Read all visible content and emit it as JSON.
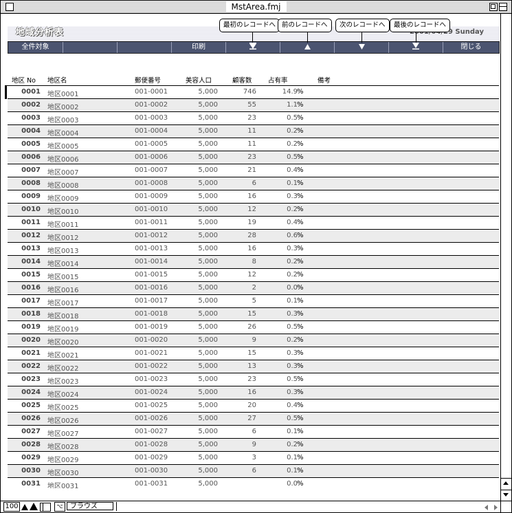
{
  "window": {
    "title": "MstArea.fmj"
  },
  "header": {
    "app_title": "地域分析表",
    "date": "2001/04/29 Sunday"
  },
  "toolbar": {
    "buttons": [
      {
        "label": "全件対象",
        "icon": ""
      },
      {
        "label": "",
        "icon": ""
      },
      {
        "label": "",
        "icon": ""
      },
      {
        "label": "印刷",
        "icon": ""
      },
      {
        "label": "",
        "icon": "first-record-icon"
      },
      {
        "label": "",
        "icon": "prev-record-icon"
      },
      {
        "label": "",
        "icon": "next-record-icon"
      },
      {
        "label": "",
        "icon": "last-record-icon"
      },
      {
        "label": "閉じる",
        "icon": ""
      }
    ]
  },
  "callouts": {
    "first": "最初のレコードへ",
    "prev": "前のレコードへ",
    "next": "次のレコードへ",
    "last": "最後のレコードへ"
  },
  "columns": {
    "no": "地区 No",
    "name": "地区名",
    "zip": "郵便番号",
    "pop": "美容人口",
    "cust": "顧客数",
    "rate": "占有率",
    "note": "備考"
  },
  "pct_symbol": "%",
  "rows": [
    {
      "no": "0001",
      "name": "地区0001",
      "zip": "001-0001",
      "pop": "5,000",
      "cust": "746",
      "rate": "14.9"
    },
    {
      "no": "0002",
      "name": "地区0002",
      "zip": "001-0002",
      "pop": "5,000",
      "cust": "55",
      "rate": "1.1"
    },
    {
      "no": "0003",
      "name": "地区0003",
      "zip": "001-0003",
      "pop": "5,000",
      "cust": "23",
      "rate": "0.5"
    },
    {
      "no": "0004",
      "name": "地区0004",
      "zip": "001-0004",
      "pop": "5,000",
      "cust": "11",
      "rate": "0.2"
    },
    {
      "no": "0005",
      "name": "地区0005",
      "zip": "001-0005",
      "pop": "5,000",
      "cust": "11",
      "rate": "0.2"
    },
    {
      "no": "0006",
      "name": "地区0006",
      "zip": "001-0006",
      "pop": "5,000",
      "cust": "23",
      "rate": "0.5"
    },
    {
      "no": "0007",
      "name": "地区0007",
      "zip": "001-0007",
      "pop": "5,000",
      "cust": "21",
      "rate": "0.4"
    },
    {
      "no": "0008",
      "name": "地区0008",
      "zip": "001-0008",
      "pop": "5,000",
      "cust": "6",
      "rate": "0.1"
    },
    {
      "no": "0009",
      "name": "地区0009",
      "zip": "001-0009",
      "pop": "5,000",
      "cust": "16",
      "rate": "0.3"
    },
    {
      "no": "0010",
      "name": "地区0010",
      "zip": "001-0010",
      "pop": "5,000",
      "cust": "12",
      "rate": "0.2"
    },
    {
      "no": "0011",
      "name": "地区0011",
      "zip": "001-0011",
      "pop": "5,000",
      "cust": "19",
      "rate": "0.4"
    },
    {
      "no": "0012",
      "name": "地区0012",
      "zip": "001-0012",
      "pop": "5,000",
      "cust": "28",
      "rate": "0.6"
    },
    {
      "no": "0013",
      "name": "地区0013",
      "zip": "001-0013",
      "pop": "5,000",
      "cust": "16",
      "rate": "0.3"
    },
    {
      "no": "0014",
      "name": "地区0014",
      "zip": "001-0014",
      "pop": "5,000",
      "cust": "8",
      "rate": "0.2"
    },
    {
      "no": "0015",
      "name": "地区0015",
      "zip": "001-0015",
      "pop": "5,000",
      "cust": "12",
      "rate": "0.2"
    },
    {
      "no": "0016",
      "name": "地区0016",
      "zip": "001-0016",
      "pop": "5,000",
      "cust": "2",
      "rate": "0.0"
    },
    {
      "no": "0017",
      "name": "地区0017",
      "zip": "001-0017",
      "pop": "5,000",
      "cust": "5",
      "rate": "0.1"
    },
    {
      "no": "0018",
      "name": "地区0018",
      "zip": "001-0018",
      "pop": "5,000",
      "cust": "15",
      "rate": "0.3"
    },
    {
      "no": "0019",
      "name": "地区0019",
      "zip": "001-0019",
      "pop": "5,000",
      "cust": "26",
      "rate": "0.5"
    },
    {
      "no": "0020",
      "name": "地区0020",
      "zip": "001-0020",
      "pop": "5,000",
      "cust": "9",
      "rate": "0.2"
    },
    {
      "no": "0021",
      "name": "地区0021",
      "zip": "001-0021",
      "pop": "5,000",
      "cust": "15",
      "rate": "0.3"
    },
    {
      "no": "0022",
      "name": "地区0022",
      "zip": "001-0022",
      "pop": "5,000",
      "cust": "13",
      "rate": "0.3"
    },
    {
      "no": "0023",
      "name": "地区0023",
      "zip": "001-0023",
      "pop": "5,000",
      "cust": "23",
      "rate": "0.5"
    },
    {
      "no": "0024",
      "name": "地区0024",
      "zip": "001-0024",
      "pop": "5,000",
      "cust": "16",
      "rate": "0.3"
    },
    {
      "no": "0025",
      "name": "地区0025",
      "zip": "001-0025",
      "pop": "5,000",
      "cust": "20",
      "rate": "0.4"
    },
    {
      "no": "0026",
      "name": "地区0026",
      "zip": "001-0026",
      "pop": "5,000",
      "cust": "27",
      "rate": "0.5"
    },
    {
      "no": "0027",
      "name": "地区0027",
      "zip": "001-0027",
      "pop": "5,000",
      "cust": "6",
      "rate": "0.1"
    },
    {
      "no": "0028",
      "name": "地区0028",
      "zip": "001-0028",
      "pop": "5,000",
      "cust": "9",
      "rate": "0.2"
    },
    {
      "no": "0029",
      "name": "地区0029",
      "zip": "001-0029",
      "pop": "5,000",
      "cust": "3",
      "rate": "0.1"
    },
    {
      "no": "0030",
      "name": "地区0030",
      "zip": "001-0030",
      "pop": "5,000",
      "cust": "6",
      "rate": "0.1"
    },
    {
      "no": "0031",
      "name": "地区0031",
      "zip": "001-0031",
      "pop": "5,000",
      "cust": "",
      "rate": "0.0"
    }
  ],
  "status": {
    "zoom": "100",
    "mode": "ブラウズ"
  }
}
